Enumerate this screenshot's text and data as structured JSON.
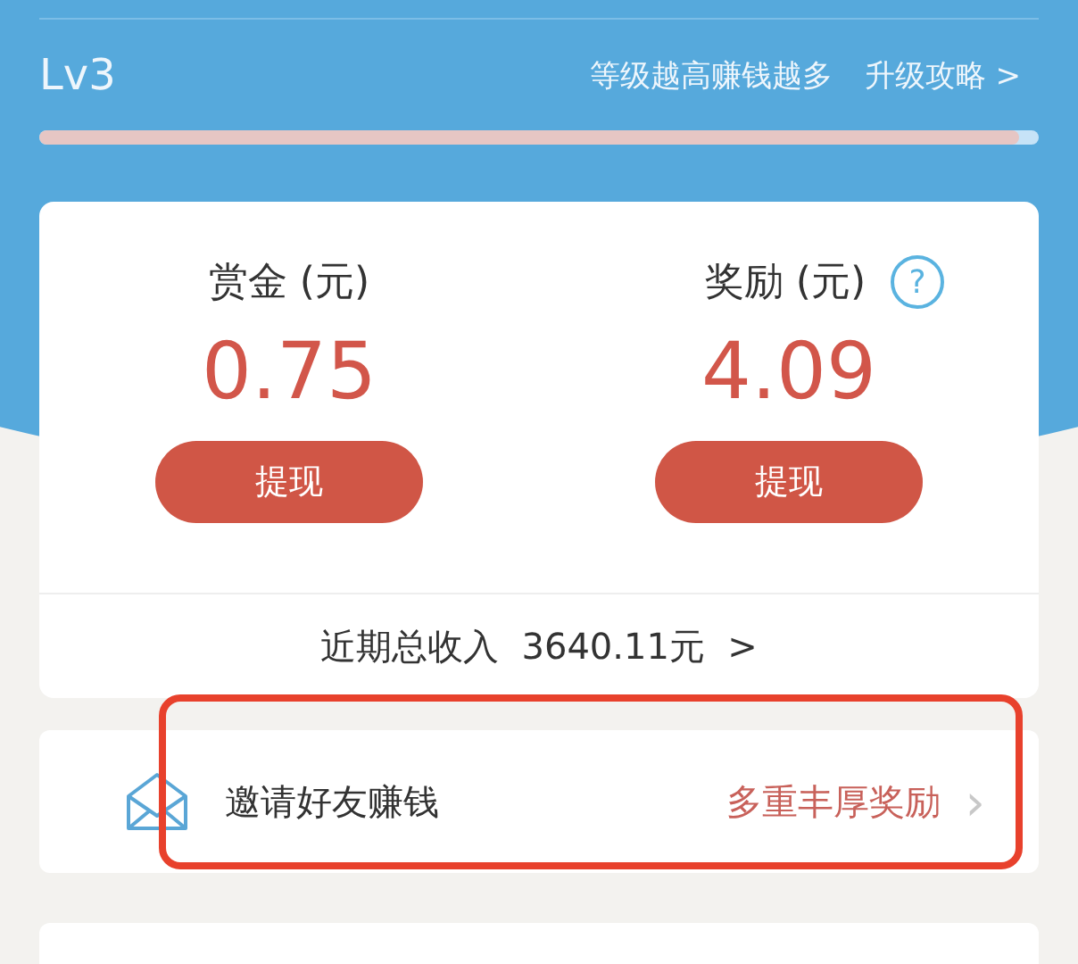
{
  "level_bar": {
    "label": "Lv3",
    "hint": "等级越高赚钱越多",
    "link": "升级攻略 >",
    "level": 0.98
  },
  "balances": [
    {
      "label": "赏金 (元)",
      "amount": "0.75",
      "button": "提现",
      "help": false
    },
    {
      "label": "奖励 (元)",
      "amount": "4.09",
      "button": "提现",
      "help": true
    }
  ],
  "help_icon": "?",
  "total": {
    "text": "近期总收入  3640.11元  >"
  },
  "invite": {
    "title": "邀请好友赚钱",
    "reward": "多重丰厚奖励",
    "chevron": "›",
    "highlighted": true
  }
}
